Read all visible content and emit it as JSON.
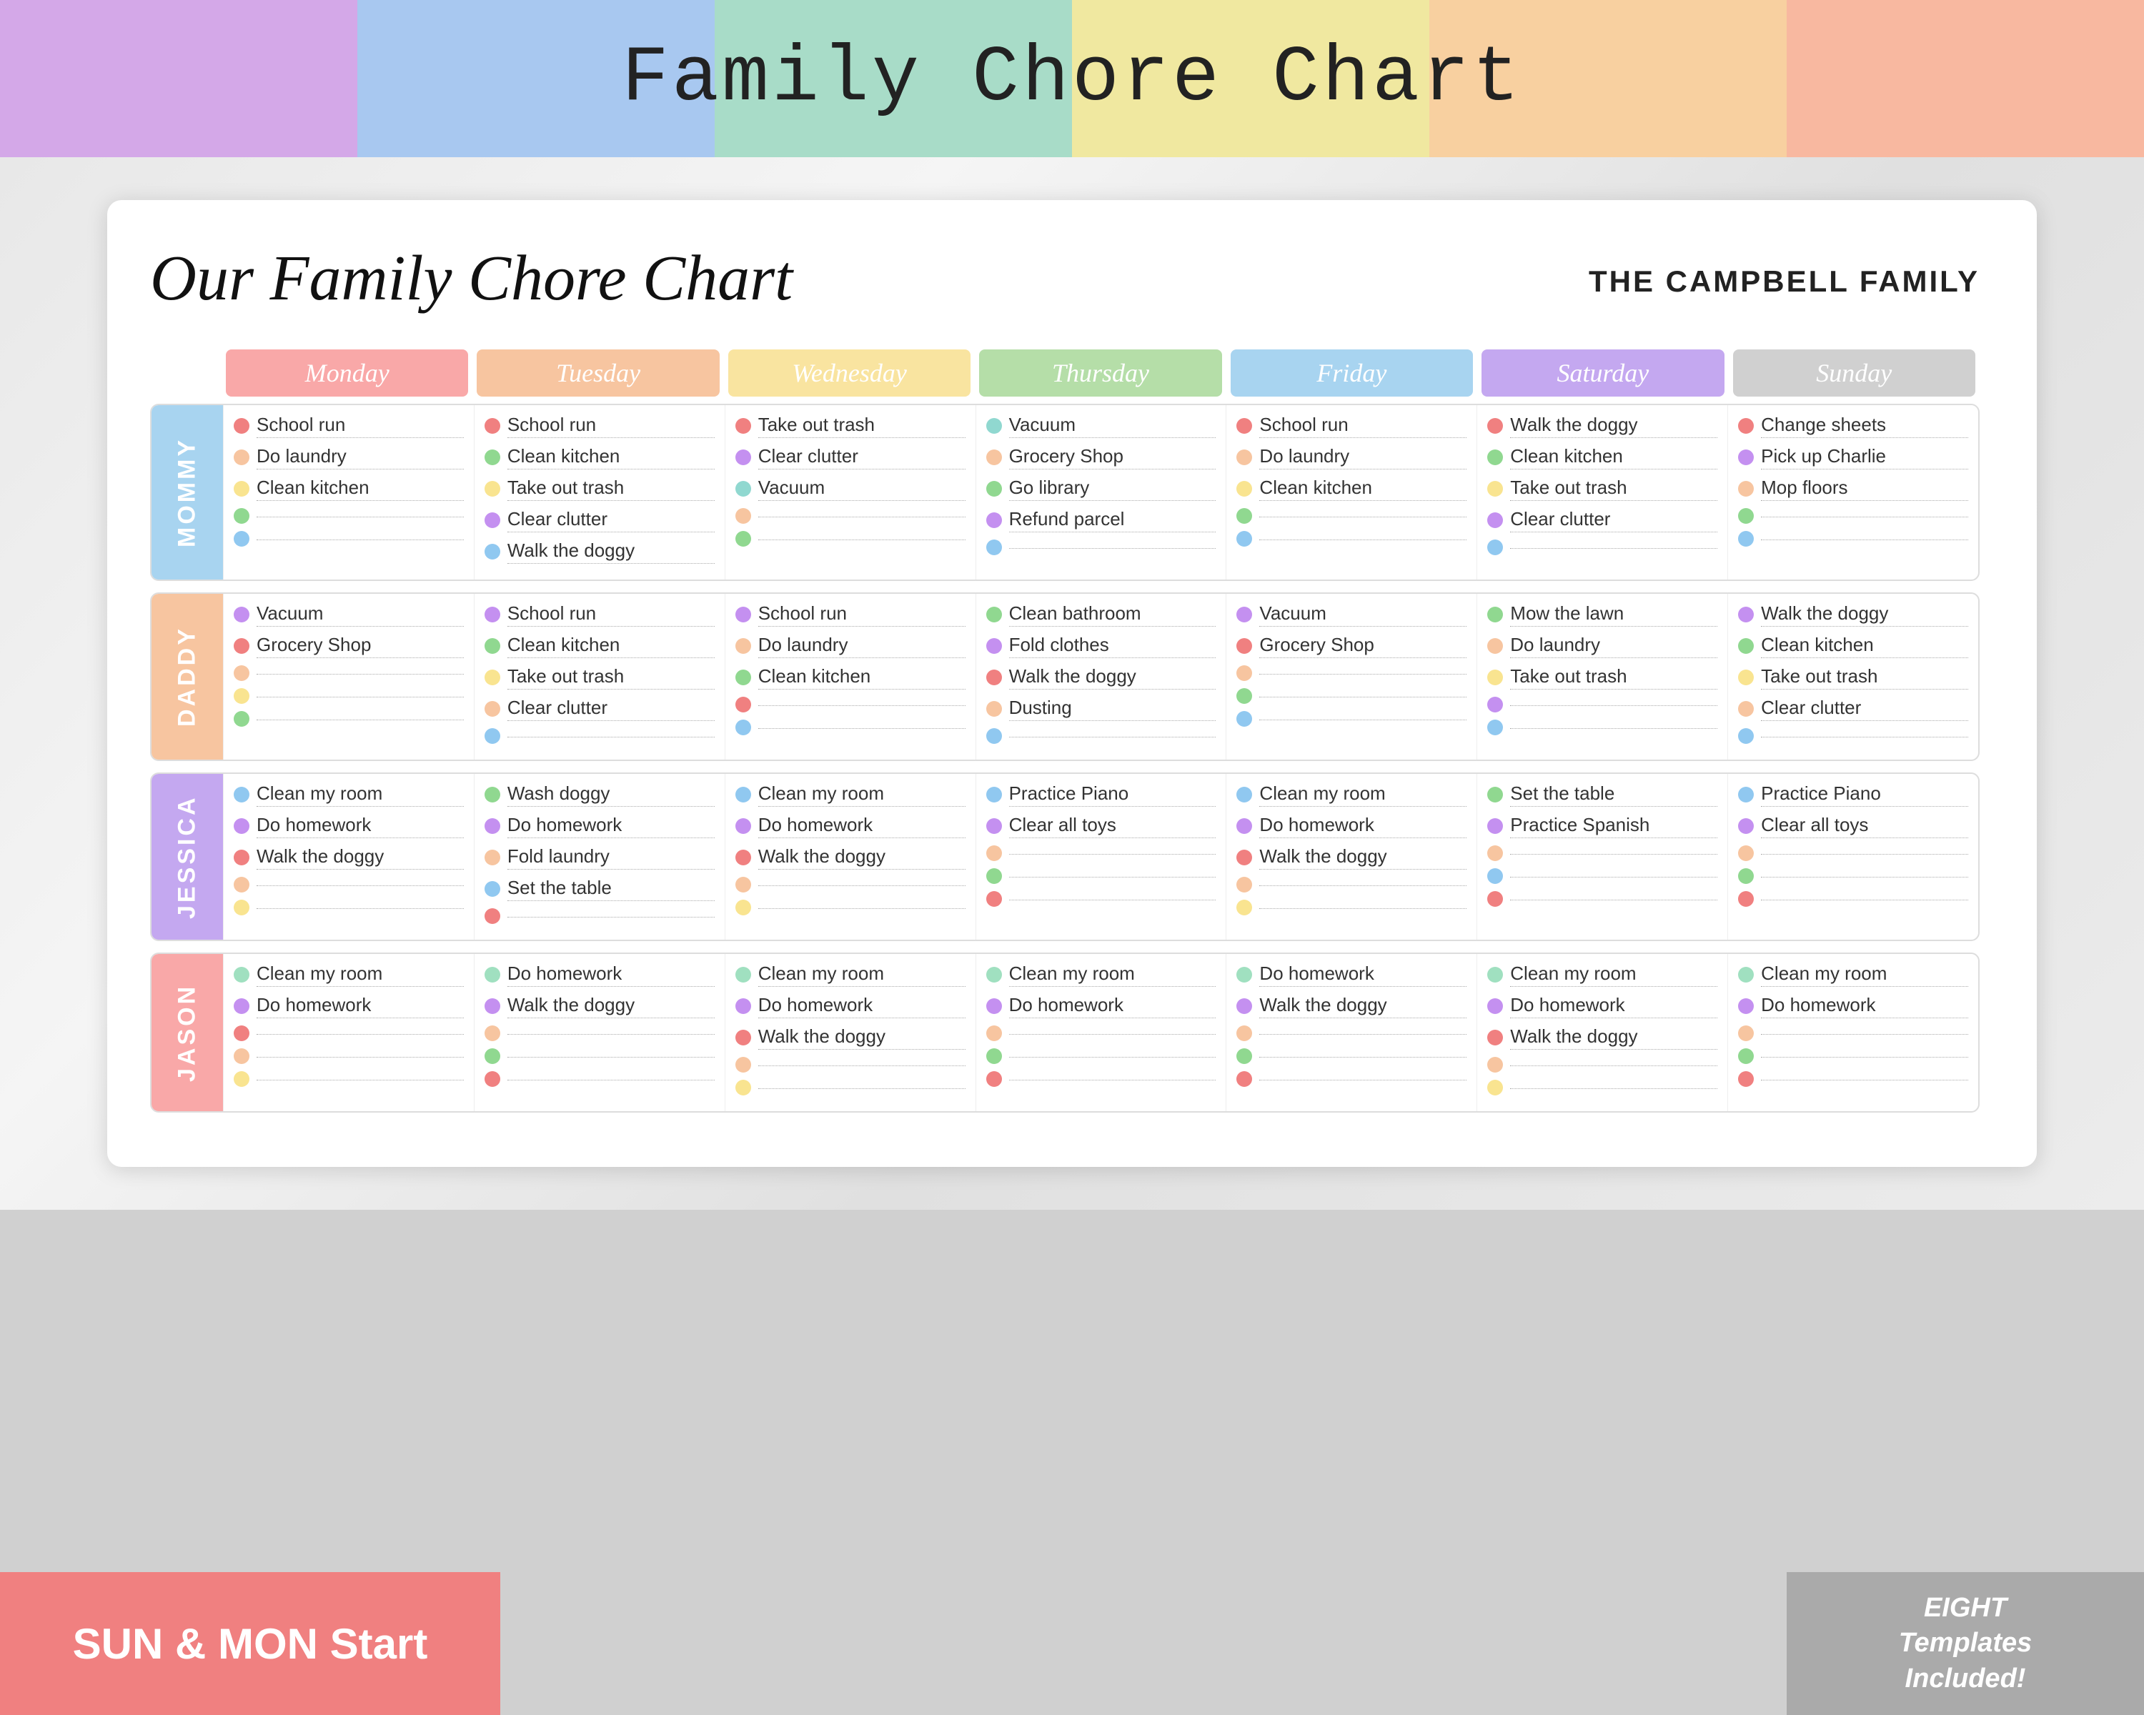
{
  "page": {
    "top_title": "Family Chore Chart",
    "family_name": "THE CAMPBELL FAMILY",
    "card_title": "Our Family Chore Chart",
    "footer_left": "SUN & MON Start",
    "footer_right": "EIGHT\nTemplates\nIncluded!"
  },
  "top_colors": [
    "#d4a8e8",
    "#a8c8f0",
    "#a8dcc8",
    "#f0e8a0",
    "#f8d0a0",
    "#f8b8a0"
  ],
  "days": [
    "Monday",
    "Tuesday",
    "Wednesday",
    "Thursday",
    "Friday",
    "Saturday",
    "Sunday"
  ],
  "day_colors": [
    "#f9a8a8",
    "#f7c5a0",
    "#f9e4a0",
    "#b5dea8",
    "#a8d4f0",
    "#c4a8f0",
    "#d0d0d0"
  ],
  "people": [
    {
      "name": "MOMMY",
      "color": "#a8d4f0",
      "days": [
        [
          {
            "dot": "red",
            "text": "School run"
          },
          {
            "dot": "orange",
            "text": "Do laundry"
          },
          {
            "dot": "yellow",
            "text": "Clean kitchen"
          },
          {
            "dot": "green",
            "text": ""
          },
          {
            "dot": "blue",
            "text": ""
          }
        ],
        [
          {
            "dot": "red",
            "text": "School run"
          },
          {
            "dot": "green",
            "text": "Clean kitchen"
          },
          {
            "dot": "yellow",
            "text": "Take out trash"
          },
          {
            "dot": "purple",
            "text": "Clear clutter"
          },
          {
            "dot": "blue",
            "text": "Walk the doggy"
          }
        ],
        [
          {
            "dot": "red",
            "text": "Take out trash"
          },
          {
            "dot": "purple",
            "text": "Clear clutter"
          },
          {
            "dot": "teal",
            "text": "Vacuum"
          },
          {
            "dot": "orange",
            "text": ""
          },
          {
            "dot": "green",
            "text": ""
          }
        ],
        [
          {
            "dot": "teal",
            "text": "Vacuum"
          },
          {
            "dot": "orange",
            "text": "Grocery Shop"
          },
          {
            "dot": "green",
            "text": "Go library"
          },
          {
            "dot": "purple",
            "text": "Refund parcel"
          },
          {
            "dot": "blue",
            "text": ""
          }
        ],
        [
          {
            "dot": "red",
            "text": "School run"
          },
          {
            "dot": "orange",
            "text": "Do laundry"
          },
          {
            "dot": "yellow",
            "text": "Clean kitchen"
          },
          {
            "dot": "green",
            "text": ""
          },
          {
            "dot": "blue",
            "text": ""
          }
        ],
        [
          {
            "dot": "red",
            "text": "Walk the doggy"
          },
          {
            "dot": "green",
            "text": "Clean kitchen"
          },
          {
            "dot": "yellow",
            "text": "Take out trash"
          },
          {
            "dot": "purple",
            "text": "Clear clutter"
          },
          {
            "dot": "blue",
            "text": ""
          }
        ],
        [
          {
            "dot": "red",
            "text": "Change sheets"
          },
          {
            "dot": "purple",
            "text": "Pick up Charlie"
          },
          {
            "dot": "orange",
            "text": "Mop floors"
          },
          {
            "dot": "green",
            "text": ""
          },
          {
            "dot": "blue",
            "text": ""
          }
        ]
      ]
    },
    {
      "name": "DADDY",
      "color": "#f7c5a0",
      "days": [
        [
          {
            "dot": "purple",
            "text": "Vacuum"
          },
          {
            "dot": "red",
            "text": "Grocery Shop"
          },
          {
            "dot": "orange",
            "text": ""
          },
          {
            "dot": "yellow",
            "text": ""
          },
          {
            "dot": "green",
            "text": ""
          }
        ],
        [
          {
            "dot": "purple",
            "text": "School run"
          },
          {
            "dot": "green",
            "text": "Clean kitchen"
          },
          {
            "dot": "yellow",
            "text": "Take out trash"
          },
          {
            "dot": "orange",
            "text": "Clear clutter"
          },
          {
            "dot": "blue",
            "text": ""
          }
        ],
        [
          {
            "dot": "purple",
            "text": "School run"
          },
          {
            "dot": "orange",
            "text": "Do laundry"
          },
          {
            "dot": "green",
            "text": "Clean kitchen"
          },
          {
            "dot": "red",
            "text": ""
          },
          {
            "dot": "blue",
            "text": ""
          }
        ],
        [
          {
            "dot": "green",
            "text": "Clean bathroom"
          },
          {
            "dot": "purple",
            "text": "Fold clothes"
          },
          {
            "dot": "red",
            "text": "Walk the doggy"
          },
          {
            "dot": "orange",
            "text": "Dusting"
          },
          {
            "dot": "blue",
            "text": ""
          }
        ],
        [
          {
            "dot": "purple",
            "text": "Vacuum"
          },
          {
            "dot": "red",
            "text": "Grocery Shop"
          },
          {
            "dot": "orange",
            "text": ""
          },
          {
            "dot": "green",
            "text": ""
          },
          {
            "dot": "blue",
            "text": ""
          }
        ],
        [
          {
            "dot": "green",
            "text": "Mow the lawn"
          },
          {
            "dot": "orange",
            "text": "Do laundry"
          },
          {
            "dot": "yellow",
            "text": "Take out trash"
          },
          {
            "dot": "purple",
            "text": ""
          },
          {
            "dot": "blue",
            "text": ""
          }
        ],
        [
          {
            "dot": "purple",
            "text": "Walk the doggy"
          },
          {
            "dot": "green",
            "text": "Clean kitchen"
          },
          {
            "dot": "yellow",
            "text": "Take out trash"
          },
          {
            "dot": "orange",
            "text": "Clear clutter"
          },
          {
            "dot": "blue",
            "text": ""
          }
        ]
      ]
    },
    {
      "name": "JESSICA",
      "color": "#c4a8f0",
      "days": [
        [
          {
            "dot": "blue",
            "text": "Clean my room"
          },
          {
            "dot": "purple",
            "text": "Do homework"
          },
          {
            "dot": "red",
            "text": "Walk the doggy"
          },
          {
            "dot": "orange",
            "text": ""
          },
          {
            "dot": "yellow",
            "text": ""
          }
        ],
        [
          {
            "dot": "green",
            "text": "Wash doggy"
          },
          {
            "dot": "purple",
            "text": "Do homework"
          },
          {
            "dot": "orange",
            "text": "Fold laundry"
          },
          {
            "dot": "blue",
            "text": "Set the table"
          },
          {
            "dot": "red",
            "text": ""
          }
        ],
        [
          {
            "dot": "blue",
            "text": "Clean my room"
          },
          {
            "dot": "purple",
            "text": "Do homework"
          },
          {
            "dot": "red",
            "text": "Walk the doggy"
          },
          {
            "dot": "orange",
            "text": ""
          },
          {
            "dot": "yellow",
            "text": ""
          }
        ],
        [
          {
            "dot": "blue",
            "text": "Practice Piano"
          },
          {
            "dot": "purple",
            "text": "Clear all toys"
          },
          {
            "dot": "orange",
            "text": ""
          },
          {
            "dot": "green",
            "text": ""
          },
          {
            "dot": "red",
            "text": ""
          }
        ],
        [
          {
            "dot": "blue",
            "text": "Clean my room"
          },
          {
            "dot": "purple",
            "text": "Do homework"
          },
          {
            "dot": "red",
            "text": "Walk the doggy"
          },
          {
            "dot": "orange",
            "text": ""
          },
          {
            "dot": "yellow",
            "text": ""
          }
        ],
        [
          {
            "dot": "green",
            "text": "Set the table"
          },
          {
            "dot": "purple",
            "text": "Practice Spanish"
          },
          {
            "dot": "orange",
            "text": ""
          },
          {
            "dot": "blue",
            "text": ""
          },
          {
            "dot": "red",
            "text": ""
          }
        ],
        [
          {
            "dot": "blue",
            "text": "Practice Piano"
          },
          {
            "dot": "purple",
            "text": "Clear all toys"
          },
          {
            "dot": "orange",
            "text": ""
          },
          {
            "dot": "green",
            "text": ""
          },
          {
            "dot": "red",
            "text": ""
          }
        ]
      ]
    },
    {
      "name": "JASON",
      "color": "#f9a8a8",
      "days": [
        [
          {
            "dot": "mint",
            "text": "Clean my room"
          },
          {
            "dot": "purple",
            "text": "Do homework"
          },
          {
            "dot": "red",
            "text": ""
          },
          {
            "dot": "orange",
            "text": ""
          },
          {
            "dot": "yellow",
            "text": ""
          }
        ],
        [
          {
            "dot": "mint",
            "text": "Do homework"
          },
          {
            "dot": "purple",
            "text": "Walk the doggy"
          },
          {
            "dot": "orange",
            "text": ""
          },
          {
            "dot": "green",
            "text": ""
          },
          {
            "dot": "red",
            "text": ""
          }
        ],
        [
          {
            "dot": "mint",
            "text": "Clean my room"
          },
          {
            "dot": "purple",
            "text": "Do homework"
          },
          {
            "dot": "red",
            "text": "Walk the doggy"
          },
          {
            "dot": "orange",
            "text": ""
          },
          {
            "dot": "yellow",
            "text": ""
          }
        ],
        [
          {
            "dot": "mint",
            "text": "Clean my room"
          },
          {
            "dot": "purple",
            "text": "Do homework"
          },
          {
            "dot": "orange",
            "text": ""
          },
          {
            "dot": "green",
            "text": ""
          },
          {
            "dot": "red",
            "text": ""
          }
        ],
        [
          {
            "dot": "mint",
            "text": "Do homework"
          },
          {
            "dot": "purple",
            "text": "Walk the doggy"
          },
          {
            "dot": "orange",
            "text": ""
          },
          {
            "dot": "green",
            "text": ""
          },
          {
            "dot": "red",
            "text": ""
          }
        ],
        [
          {
            "dot": "mint",
            "text": "Clean my room"
          },
          {
            "dot": "purple",
            "text": "Do homework"
          },
          {
            "dot": "red",
            "text": "Walk the doggy"
          },
          {
            "dot": "orange",
            "text": ""
          },
          {
            "dot": "yellow",
            "text": ""
          }
        ],
        [
          {
            "dot": "mint",
            "text": "Clean my room"
          },
          {
            "dot": "purple",
            "text": "Do homework"
          },
          {
            "dot": "orange",
            "text": ""
          },
          {
            "dot": "green",
            "text": ""
          },
          {
            "dot": "red",
            "text": ""
          }
        ]
      ]
    }
  ]
}
